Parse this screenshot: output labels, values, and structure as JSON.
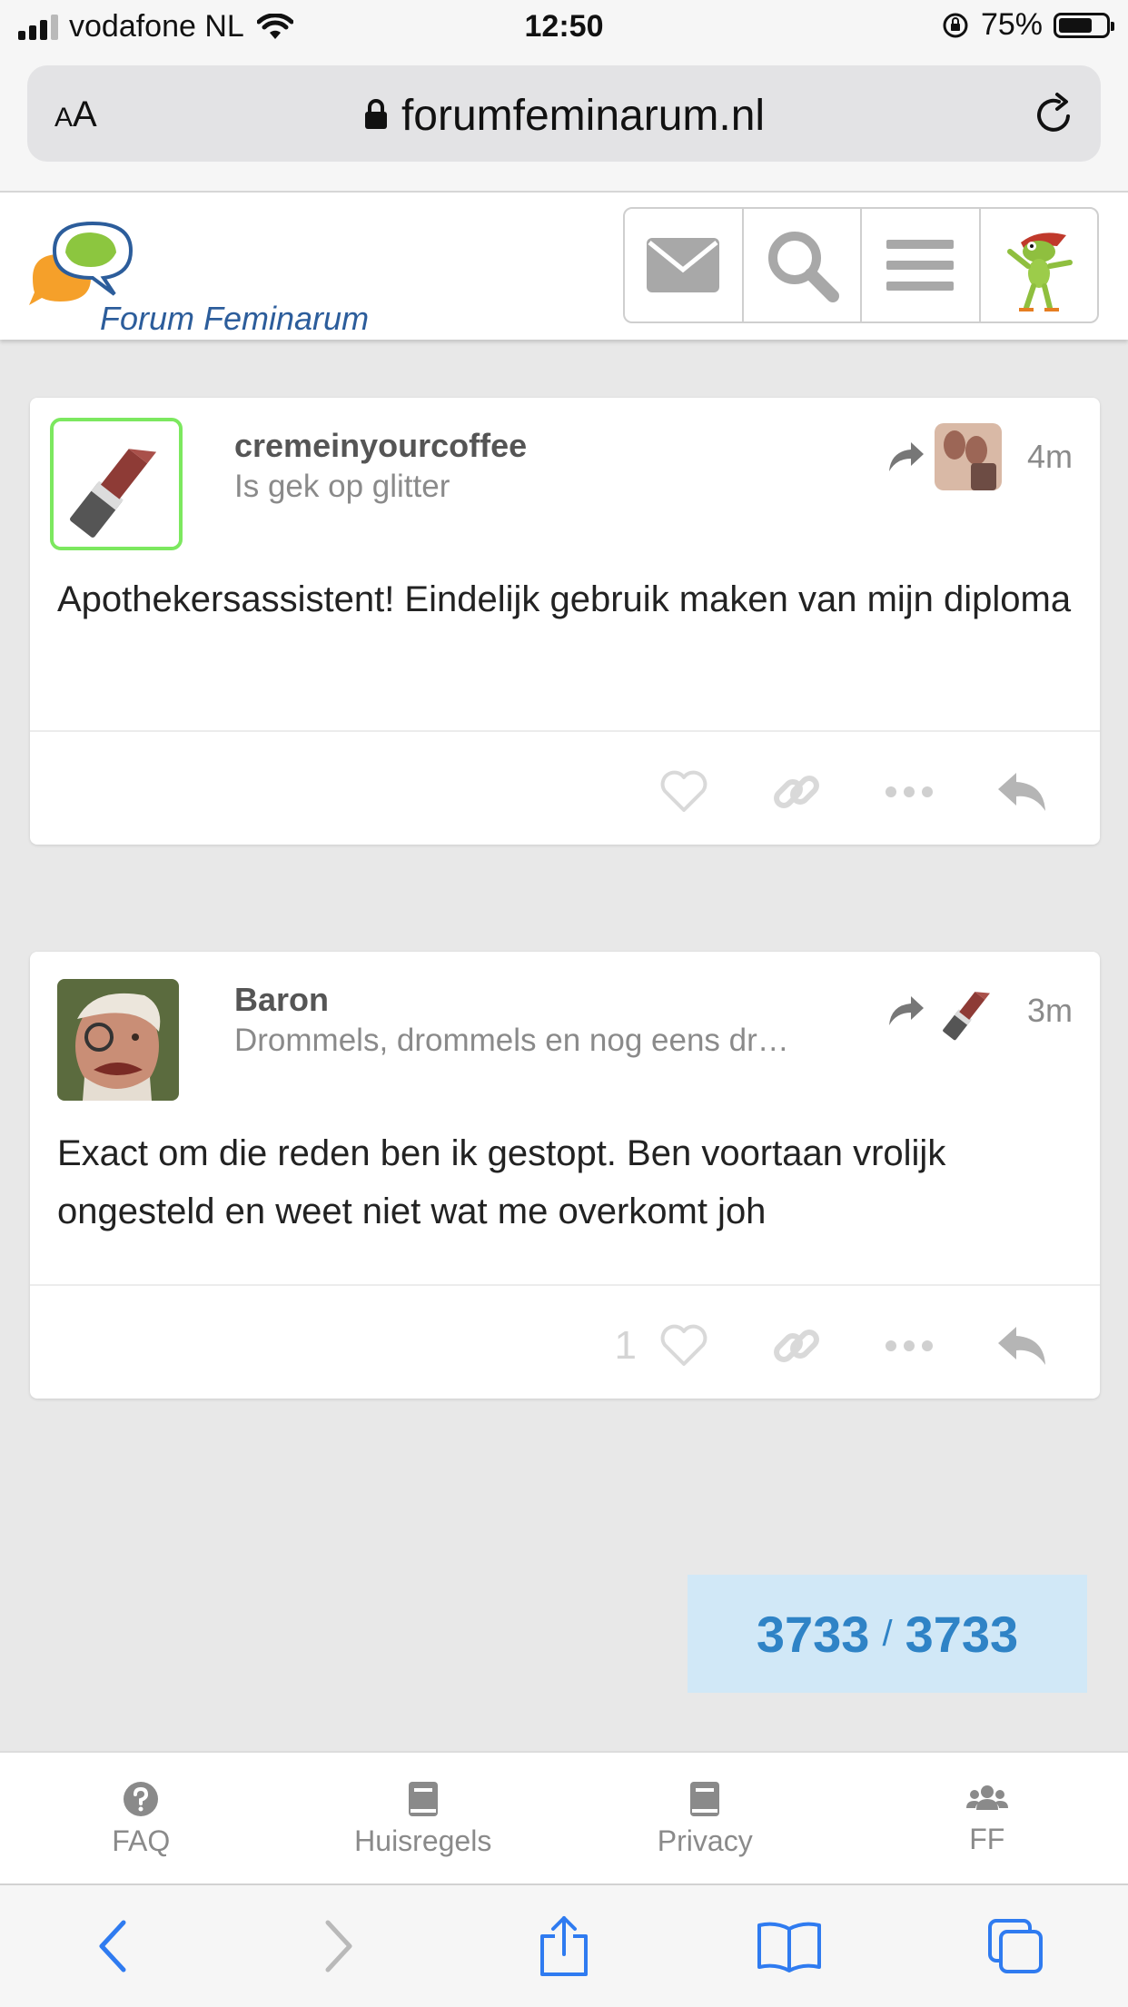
{
  "status_bar": {
    "carrier": "vodafone NL",
    "time": "12:50",
    "battery": "75%",
    "battery_level": 0.75
  },
  "browser": {
    "text_size_label": "AA",
    "url": "forumfeminarum.nl"
  },
  "site": {
    "logo_text": "Forum Feminarum",
    "nav": [
      "mail-icon",
      "search-icon",
      "menu-icon",
      "user-avatar"
    ]
  },
  "posts": [
    {
      "username": "cremeinyourcoffee",
      "user_title": "Is gek op glitter",
      "time_ago": "4m",
      "body": "Apothekersassistent! Eindelijk gebruik maken van mijn diploma",
      "like_count": ""
    },
    {
      "username": "Baron",
      "user_title": "Drommels, drommels en nog eens dr…",
      "time_ago": "3m",
      "body": "Exact om die reden ben ik gestopt. Ben voortaan vrolijk ongesteld en weet niet wat me overkomt joh",
      "like_count": "1"
    }
  ],
  "topic_progress": {
    "current": "3733",
    "separator": "/",
    "total": "3733"
  },
  "footer": {
    "items": [
      {
        "label": "FAQ",
        "icon": "question-icon"
      },
      {
        "label": "Huisregels",
        "icon": "book-icon"
      },
      {
        "label": "Privacy",
        "icon": "book-icon"
      },
      {
        "label": "FF",
        "icon": "users-icon"
      }
    ]
  },
  "safari_toolbar": [
    "back-icon",
    "forward-icon",
    "share-icon",
    "bookmarks-icon",
    "tabs-icon"
  ],
  "colors": {
    "accent_blue": "#2f83c6",
    "progress_bg": "#d1e8f7",
    "flair_green": "#7ce85f",
    "page_bg": "#e8e8e8"
  }
}
